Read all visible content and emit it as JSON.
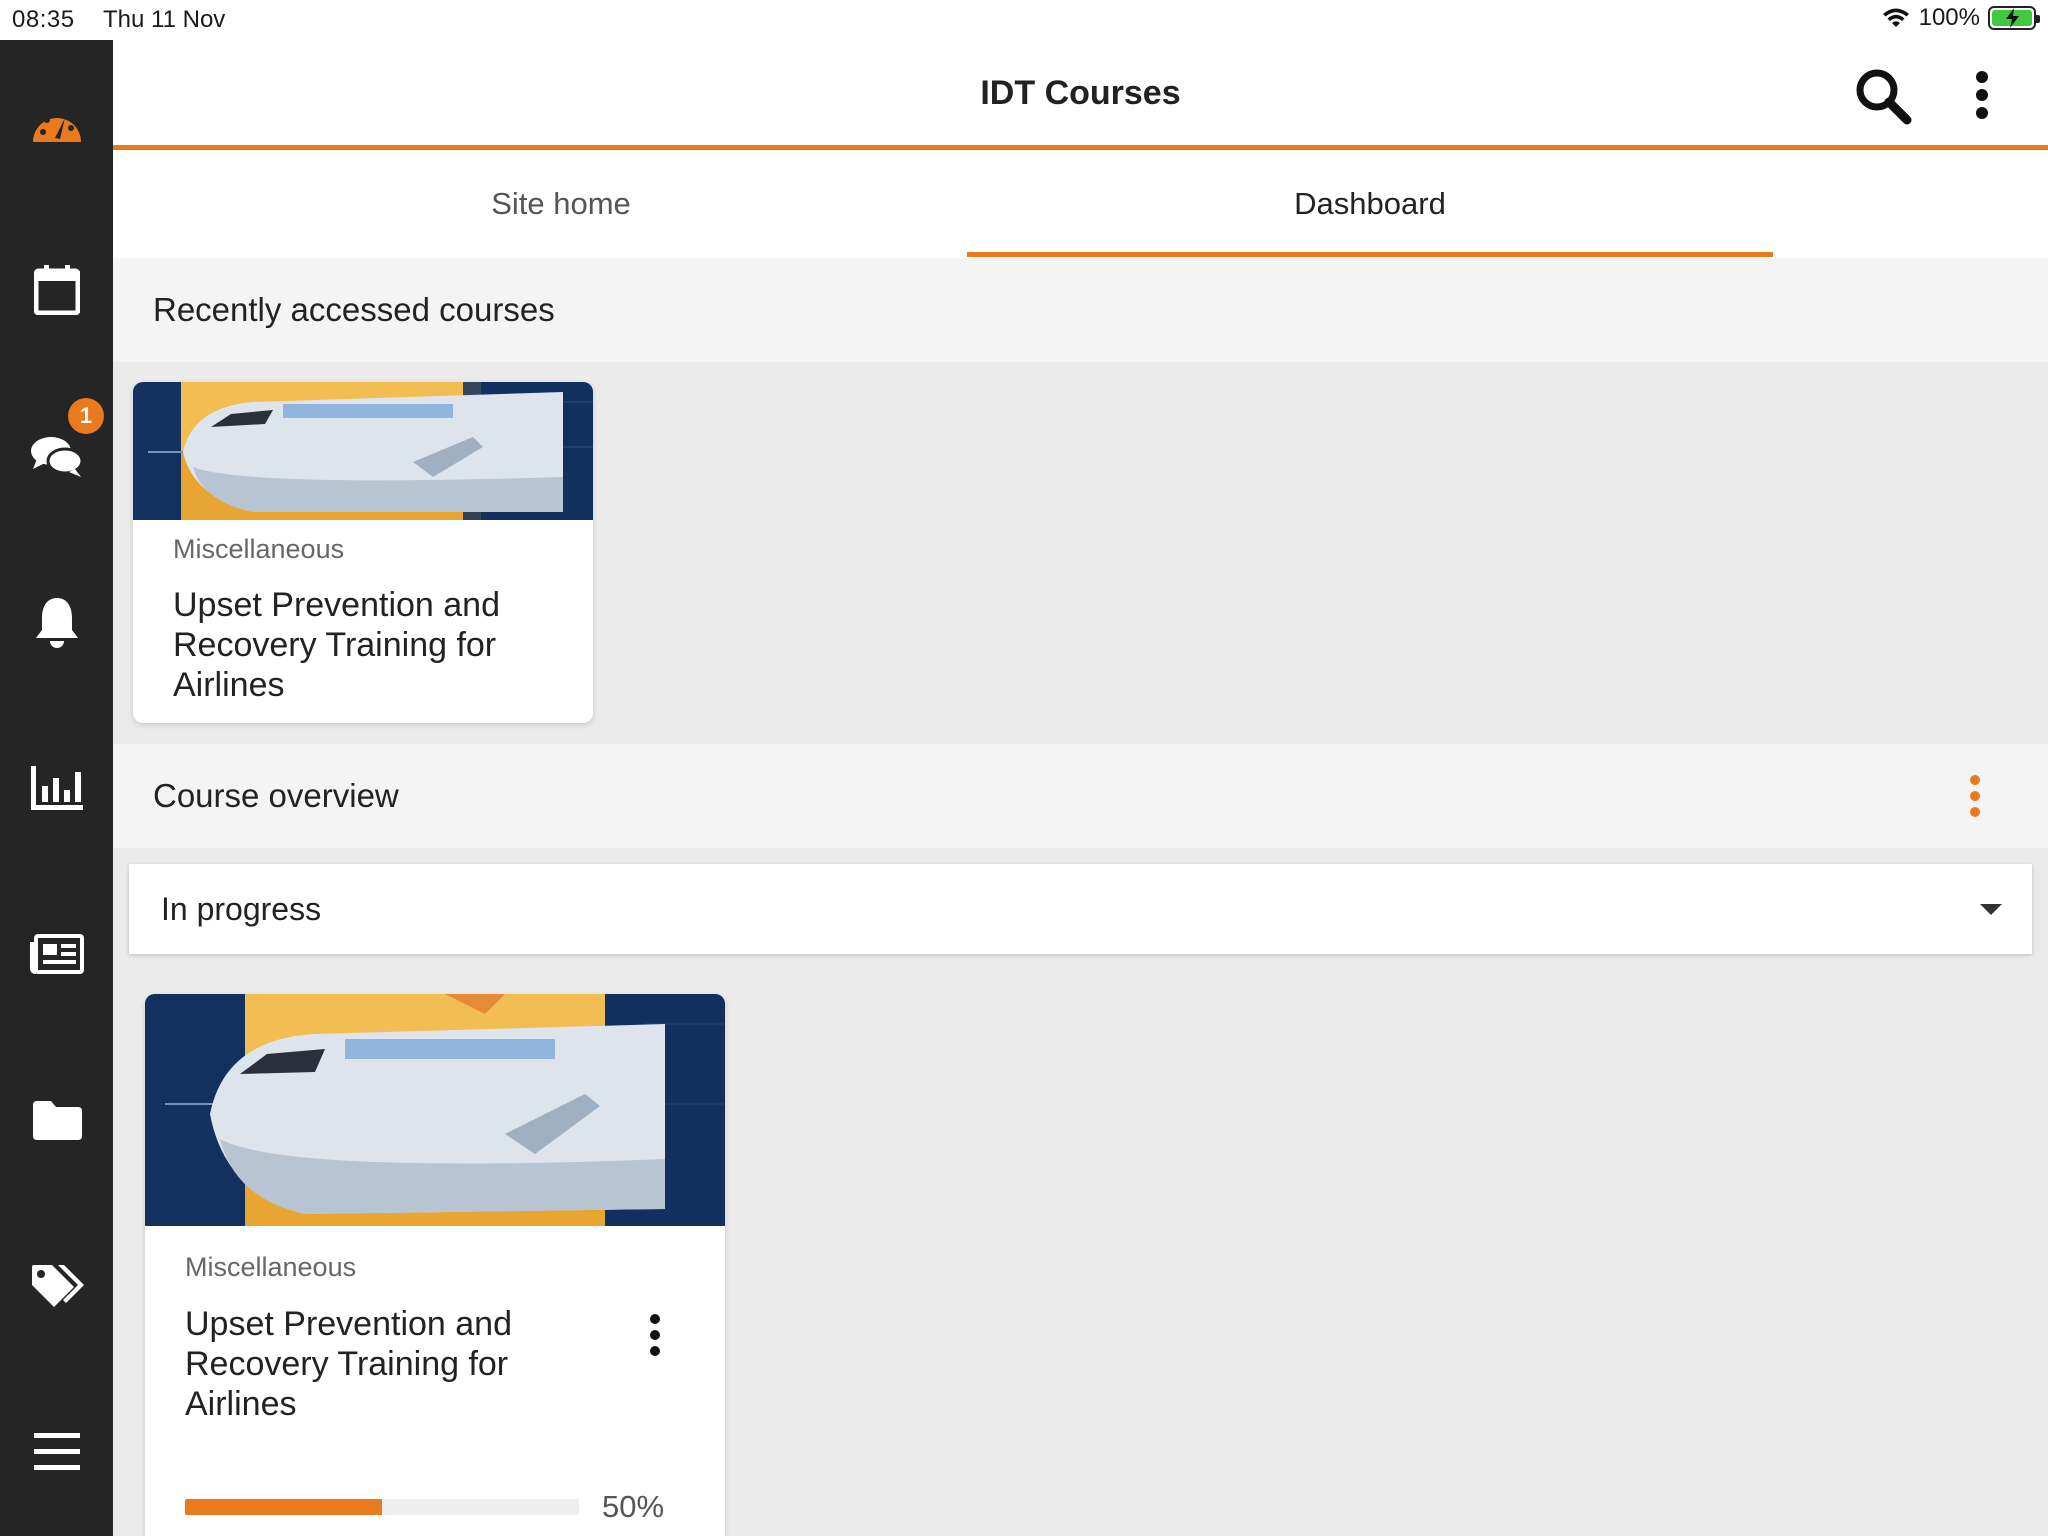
{
  "status_bar": {
    "time": "08:35",
    "date": "Thu 11 Nov",
    "battery": "100%"
  },
  "header": {
    "title": "IDT Courses"
  },
  "tabs": [
    {
      "label": "Site home",
      "active": false
    },
    {
      "label": "Dashboard",
      "active": true
    }
  ],
  "sidebar": {
    "items": [
      {
        "icon": "dashboard-gauge-icon",
        "active": true
      },
      {
        "icon": "calendar-icon"
      },
      {
        "icon": "messages-icon",
        "badge": "1"
      },
      {
        "icon": "notifications-bell-icon"
      },
      {
        "icon": "grades-chart-icon"
      },
      {
        "icon": "news-icon"
      },
      {
        "icon": "files-folder-icon"
      },
      {
        "icon": "tags-icon"
      },
      {
        "icon": "menu-icon"
      }
    ]
  },
  "recent": {
    "heading": "Recently accessed courses",
    "course": {
      "category": "Miscellaneous",
      "name_lines": [
        "Upset Prevention and",
        "Recovery Training for",
        "Airlines"
      ]
    }
  },
  "overview": {
    "heading": "Course overview",
    "filter": {
      "selected": "In progress"
    },
    "course": {
      "category": "Miscellaneous",
      "name_lines": [
        "Upset Prevention and",
        "Recovery Training for",
        "Airlines"
      ],
      "progress_percent": 50,
      "progress_label": "50%"
    }
  },
  "colors": {
    "accent": "#ea7a1e",
    "rail": "#252525",
    "navy": "#13305e"
  }
}
